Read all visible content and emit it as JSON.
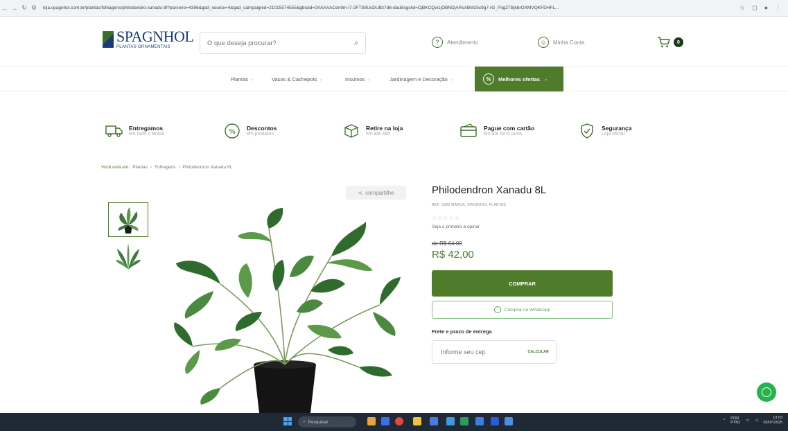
{
  "browser": {
    "url": "loja.spagnhol.com.br/plantas/folhagens/philodendro-xanadu-8l?parceiro=4396&gad_source=4&gad_campaignid=21015574555&gbraid=0AAAAACemfm-i7-2FTS8UsDUBz7d6-dauBsgclid=CjBKCQw1jOBNDjARsABM25c9g7-rG_Psg2TBjkbrOXMVQKFDHFL..."
  },
  "header": {
    "logo_name": "SPAGNHOL",
    "logo_sub": "PLANTAS ORNAMENTAIS",
    "search_placeholder": "O que deseja procurar?",
    "atendimento": "Atendimento",
    "minha_conta": "Minha Conta",
    "cart_count": "0"
  },
  "nav": {
    "items": [
      {
        "label": "Plantas"
      },
      {
        "label": "Vasos & Cachepots"
      },
      {
        "label": "Insumos"
      },
      {
        "label": "Jardinagem e Decoração"
      }
    ],
    "promo": "Melhores ofertas"
  },
  "benefits": [
    {
      "title": "Entregamos",
      "sub": "em todo o Brasil",
      "icon": "truck-icon"
    },
    {
      "title": "Descontos",
      "sub": "em produtos",
      "icon": "discount-icon"
    },
    {
      "title": "Retire na loja",
      "sub": "em até 48h",
      "icon": "box-icon"
    },
    {
      "title": "Pague com cartão",
      "sub": "em até 6x s/ juros",
      "icon": "card-icon"
    },
    {
      "title": "Segurança",
      "sub": "Loja oficial",
      "icon": "shield-icon"
    }
  ],
  "breadcrumb": {
    "prefix": "Você está em:",
    "items": [
      "Plantas",
      "Folhagens",
      "Philodendron Xanadu 8L"
    ],
    "separator": "›"
  },
  "product": {
    "share": "compartilhe",
    "title": "Philodendron Xanadu 8L",
    "ref": "REF: 6305   MARCA: SPAGNHOL PLANTAS",
    "stars": "☆☆☆☆☆",
    "review_cta": "Seja o primeiro a opinar",
    "old_price": "de R$ 64,00",
    "price": "R$ 42,00",
    "buy_label": "COMPRAR",
    "whatsapp_label": "Comprar no WhatsApp",
    "frete_label": "Frete e prazo de entrega",
    "cep_placeholder": "Informe seu cep",
    "calc_label": "CALCULAR"
  },
  "taskbar": {
    "search": "Pesquisar",
    "lang_top": "POR",
    "lang_bottom": "PTB2",
    "time": "13:03",
    "date": "03/07/2025"
  },
  "colors": {
    "brand_green": "#4e7c2a",
    "brand_blue": "#1b3c7a",
    "whatsapp": "#25b34a"
  }
}
